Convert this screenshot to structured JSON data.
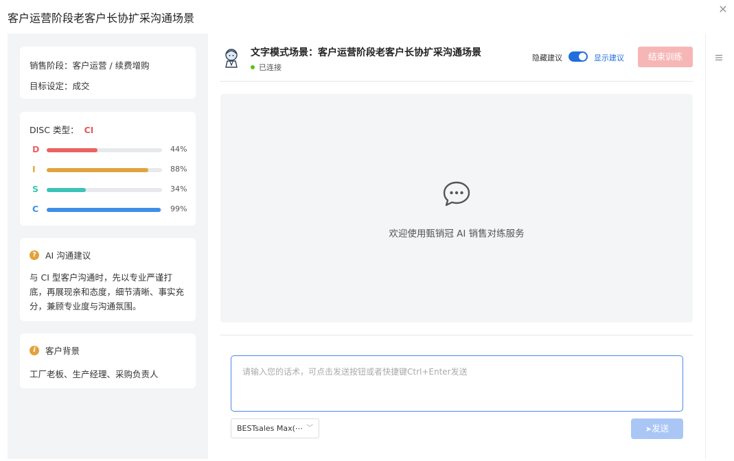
{
  "dialog": {
    "title": "客户运营阶段老客户长协扩采沟通场景",
    "close_icon": "close-icon"
  },
  "left_panel": {
    "stage": "销售阶段：客户运营 / 续费增购",
    "goal": "目标设定：成交",
    "disc": {
      "label": "DISC 类型：",
      "type": "CI",
      "bars": [
        {
          "letter": "D",
          "percent": 44,
          "percent_label": "44%",
          "color": "#ea6363"
        },
        {
          "letter": "I",
          "percent": 88,
          "percent_label": "88%",
          "color": "#e0a43f"
        },
        {
          "letter": "S",
          "percent": 34,
          "percent_label": "34%",
          "color": "#3cc3b7"
        },
        {
          "letter": "C",
          "percent": 99,
          "percent_label": "99%",
          "color": "#3f8ee8"
        }
      ]
    },
    "ai_advice": {
      "title": "AI 沟通建议",
      "icon": "question-circle-icon",
      "text": "与 CI 型客户沟通时，先以专业严谨打底，再展现亲和态度，细节清晰、事实充分，兼顾专业度与沟通氛围。"
    },
    "background": {
      "title": "客户背景",
      "icon": "info-circle-icon",
      "text": "工厂老板、生产经理、采购负责人"
    }
  },
  "main": {
    "scene_title": "文字模式场景：客户运营阶段老客户长协扩采沟通场景",
    "status": "已连接",
    "hide_suggestion": "隐藏建议",
    "show_suggestion": "显示建议",
    "end_button": "结束训练",
    "welcome": "欢迎使用甄销冠 AI 销售对练服务",
    "input_placeholder": "请输入您的话术，可点击发送按钮或者快捷键Ctrl+Enter发送",
    "model": "BESTsales Max(⋯",
    "send_button": "发送"
  },
  "colors": {
    "accent": "#1f6fdc",
    "end_button_bg": "#f7b6b6",
    "send_button_bg": "#a9c6f5",
    "connected": "#52c41a"
  }
}
